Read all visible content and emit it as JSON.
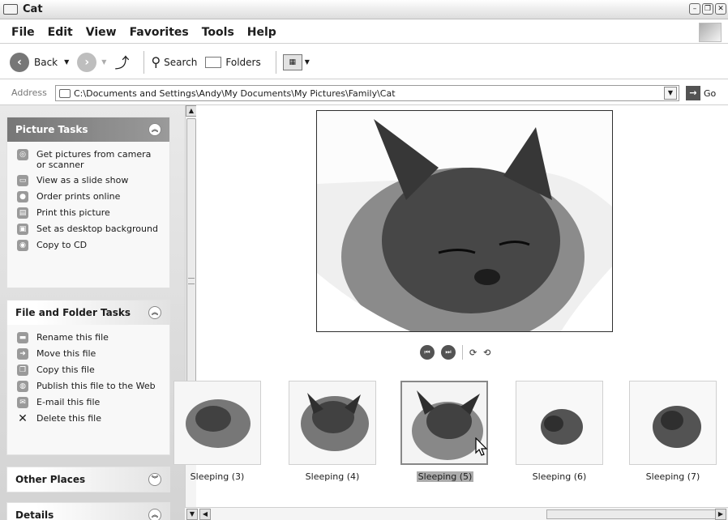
{
  "window": {
    "title": "Cat",
    "controls": [
      "–",
      "❐",
      "✕"
    ]
  },
  "menu": [
    "File",
    "Edit",
    "View",
    "Favorites",
    "Tools",
    "Help"
  ],
  "toolbar": {
    "back": "Back",
    "search": "Search",
    "folders": "Folders"
  },
  "address": {
    "label": "Address",
    "path": "C:\\Documents and Settings\\Andy\\My Documents\\My Pictures\\Family\\Cat",
    "go": "Go"
  },
  "picture_tasks": {
    "title": "Picture Tasks",
    "items": [
      {
        "label": "Get pictures from camera or scanner",
        "icon": "camera-icon"
      },
      {
        "label": "View as a slide show",
        "icon": "slideshow-icon"
      },
      {
        "label": "Order prints online",
        "icon": "order-prints-icon"
      },
      {
        "label": "Print this picture",
        "icon": "printer-icon"
      },
      {
        "label": "Set as desktop background",
        "icon": "desktop-icon"
      },
      {
        "label": "Copy to CD",
        "icon": "cd-icon"
      }
    ]
  },
  "file_tasks": {
    "title": "File and Folder Tasks",
    "items": [
      {
        "label": "Rename this file",
        "icon": "rename-icon"
      },
      {
        "label": "Move this file",
        "icon": "move-icon"
      },
      {
        "label": "Copy this file",
        "icon": "copy-icon"
      },
      {
        "label": "Publish this file to the Web",
        "icon": "publish-icon"
      },
      {
        "label": "E-mail this file",
        "icon": "email-icon"
      },
      {
        "label": "Delete this file",
        "icon": "delete-icon"
      }
    ]
  },
  "other_places": {
    "title": "Other Places"
  },
  "details": {
    "title": "Details"
  },
  "thumbnails": [
    {
      "label": "Sleeping (3)",
      "selected": false
    },
    {
      "label": "Sleeping (4)",
      "selected": false
    },
    {
      "label": "Sleeping (5)",
      "selected": true
    },
    {
      "label": "Sleeping (6)",
      "selected": false
    },
    {
      "label": "Sleeping (7)",
      "selected": false
    }
  ]
}
